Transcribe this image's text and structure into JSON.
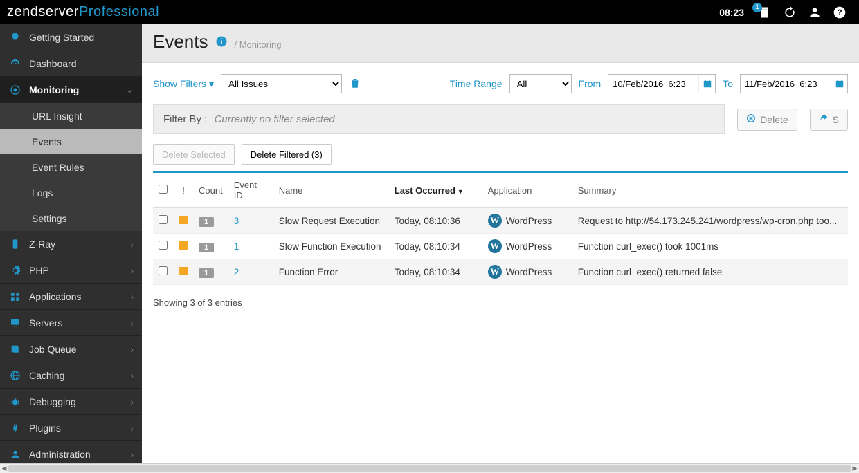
{
  "topbar": {
    "clock": "08:23",
    "notif_badge": "1"
  },
  "logo": {
    "a": "zend",
    "b": "server",
    "c": "Professional"
  },
  "sidebar": {
    "items": [
      {
        "id": "getting-started",
        "label": "Getting Started",
        "icon": "bulb"
      },
      {
        "id": "dashboard",
        "label": "Dashboard",
        "icon": "gauge"
      },
      {
        "id": "monitoring",
        "label": "Monitoring",
        "icon": "target",
        "expanded": true,
        "active": true,
        "subs": [
          {
            "id": "url-insight",
            "label": "URL Insight"
          },
          {
            "id": "events",
            "label": "Events",
            "selected": true
          },
          {
            "id": "event-rules",
            "label": "Event Rules"
          },
          {
            "id": "logs",
            "label": "Logs"
          },
          {
            "id": "settings",
            "label": "Settings"
          }
        ]
      },
      {
        "id": "zray",
        "label": "Z-Ray",
        "icon": "phone"
      },
      {
        "id": "php",
        "label": "PHP",
        "icon": "gear"
      },
      {
        "id": "applications",
        "label": "Applications",
        "icon": "grid"
      },
      {
        "id": "servers",
        "label": "Servers",
        "icon": "monitor"
      },
      {
        "id": "jobqueue",
        "label": "Job Queue",
        "icon": "stack"
      },
      {
        "id": "caching",
        "label": "Caching",
        "icon": "globe"
      },
      {
        "id": "debugging",
        "label": "Debugging",
        "icon": "bug"
      },
      {
        "id": "plugins",
        "label": "Plugins",
        "icon": "plug"
      },
      {
        "id": "administration",
        "label": "Administration",
        "icon": "user"
      }
    ]
  },
  "page": {
    "title": "Events",
    "breadcrumb": "/ Monitoring"
  },
  "filters": {
    "show_filters": "Show Filters",
    "issues_select": "All Issues",
    "time_range_label": "Time Range",
    "time_range_value": "All",
    "from_label": "From",
    "from_value": "10/Feb/2016  6:23",
    "to_label": "To",
    "to_value": "11/Feb/2016  6:23"
  },
  "filterbar": {
    "label": "Filter By :",
    "current": "Currently no filter selected",
    "delete": "Delete",
    "share": "S"
  },
  "actions": {
    "delete_selected": "Delete Selected",
    "delete_filtered": "Delete Filtered (3)"
  },
  "cols": {
    "sev": "!",
    "count": "Count",
    "event_id": "Event ID",
    "name": "Name",
    "last": "Last Occurred",
    "app": "Application",
    "summary": "Summary"
  },
  "rows": [
    {
      "count": "1",
      "eid": "3",
      "name": "Slow Request Execution",
      "last": "Today, 08:10:36",
      "app": "WordPress",
      "summary": "Request to http://54.173.245.241/wordpress/wp-cron.php too..."
    },
    {
      "count": "1",
      "eid": "1",
      "name": "Slow Function Execution",
      "last": "Today, 08:10:34",
      "app": "WordPress",
      "summary": "Function curl_exec() took 1001ms"
    },
    {
      "count": "1",
      "eid": "2",
      "name": "Function Error",
      "last": "Today, 08:10:34",
      "app": "WordPress",
      "summary": "Function curl_exec() returned false"
    }
  ],
  "footer": {
    "showing": "Showing 3 of 3 entries"
  }
}
